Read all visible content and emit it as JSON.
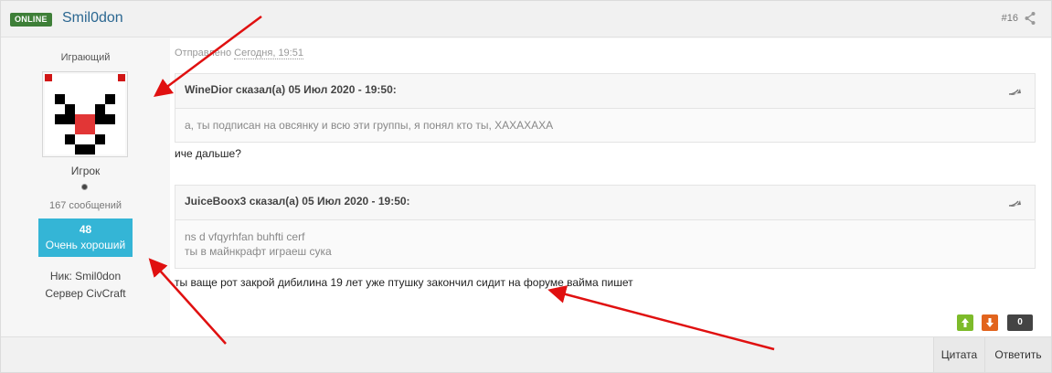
{
  "header": {
    "online_badge": "ONLINE",
    "username": "Smil0don",
    "post_number": "#16",
    "share_icon": "share-icon"
  },
  "author": {
    "member_title": "Играющий",
    "rank": "Игрок",
    "post_count": "167 сообщений",
    "reputation_value": "48",
    "reputation_label": "Очень хороший",
    "nick_label": "Ник:",
    "nick_value": "Smil0don",
    "server_label": "Сервер",
    "server_value": "CivCraft"
  },
  "post": {
    "posted_label": "Отправлено",
    "posted_time": "Сегодня, 19:51",
    "quotes": [
      {
        "head": "WineDior сказал(а) 05 Июл 2020 - 19:50:",
        "lines": [
          "а, ты подписан на овсянку и всю эти группы, я понял кто ты, ХАХАХАХА"
        ]
      },
      {
        "head": "JuiceBoox3 сказал(а) 05 Июл 2020 - 19:50:",
        "lines": [
          "ns d vfqyrhfan buhfti cerf",
          "ты в майнкрафт играеш сука"
        ]
      }
    ],
    "reply_1": "иче дальше?",
    "reply_2": "ты ваще рот закрой дибилина 19 лет уже птушку закончил сидит на форуме вайма пишет"
  },
  "votes": {
    "count": "0",
    "up_icon": "arrow-up-icon",
    "down_icon": "arrow-down-icon"
  },
  "footer": {
    "quote_button": "Цитата",
    "reply_button": "Ответить"
  },
  "colors": {
    "online_badge": "#3e7f38",
    "username": "#2b6791",
    "reputation": "#34b5d6",
    "vote_up": "#7dbb2a",
    "vote_down": "#e2641d",
    "annotation_arrows": "#e01010"
  }
}
